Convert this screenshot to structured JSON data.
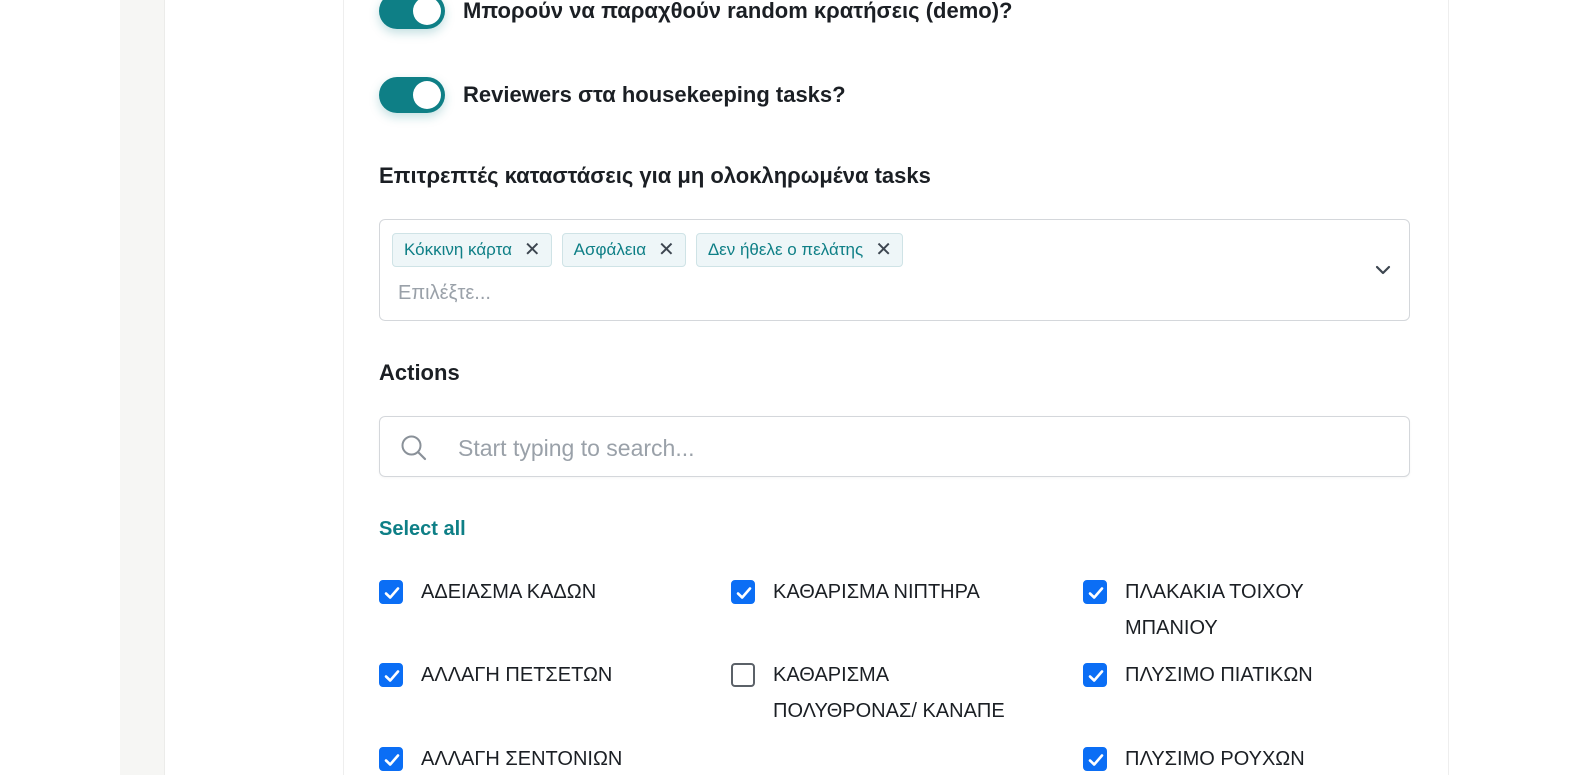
{
  "settings": {
    "toggles": [
      {
        "label": "Μπορούν να παραχθούν random κρατήσεις (demo)?",
        "on": true
      },
      {
        "label": "Reviewers στα housekeeping tasks?",
        "on": true
      }
    ],
    "allowed_states": {
      "label": "Επιτρεπτές καταστάσεις για μη ολοκληρωμένα tasks",
      "chips": [
        "Κόκκινη κάρτα",
        "Ασφάλεια",
        "Δεν ήθελε ο πελάτης"
      ],
      "placeholder": "Επιλέξτε..."
    },
    "actions": {
      "label": "Actions",
      "search_placeholder": "Start typing to search...",
      "select_all": "Select all",
      "items": [
        {
          "label": "ΑΔΕΙΑΣΜΑ ΚΑΔΩΝ",
          "checked": true
        },
        {
          "label": "ΚΑΘΑΡΙΣΜΑ ΝΙΠΤΗΡΑ",
          "checked": true
        },
        {
          "label": "ΠΛΑΚΑΚΙΑ ΤΟΙΧΟΥ ΜΠΑΝΙΟΥ",
          "checked": true
        },
        {
          "label": "ΑΛΛΑΓΗ ΠΕΤΣΕΤΩΝ",
          "checked": true
        },
        {
          "label": "ΚΑΘΑΡΙΣΜΑ ΠΟΛΥΘΡΟΝΑΣ/ ΚΑΝΑΠΕ",
          "checked": false
        },
        {
          "label": "ΠΛΥΣΙΜΟ ΠΙΑΤΙΚΩΝ",
          "checked": true
        },
        {
          "label": "ΑΛΛΑΓΗ ΣΕΝΤΟΝΙΩΝ",
          "checked": true
        },
        {
          "label": "ΠΛΥΣΙΜΟ ΡΟΥΧΩΝ",
          "checked": true
        }
      ]
    }
  },
  "colors": {
    "accent": "#0e7f86",
    "checkbox": "#0b6ef5",
    "placeholder": "#9aa1a9"
  },
  "icons": {
    "chip_remove": "close-icon",
    "dropdown": "chevron-down-icon",
    "search": "search-icon",
    "check": "check-icon"
  }
}
